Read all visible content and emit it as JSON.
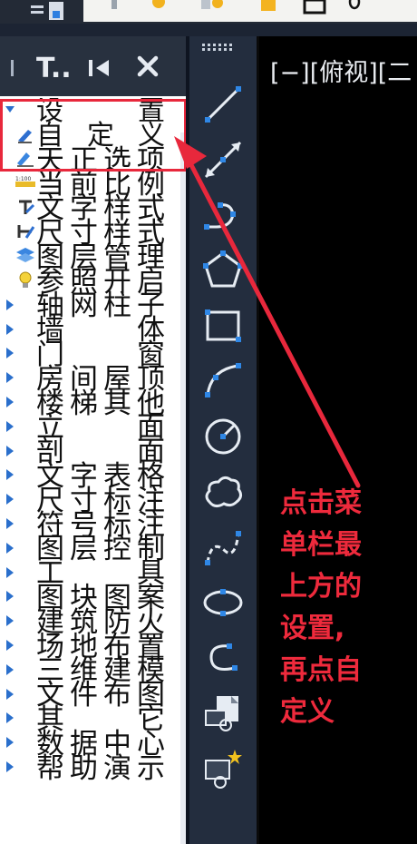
{
  "panel": {
    "title": "T..",
    "tree": [
      {
        "label": "设　置",
        "expanded": true,
        "icon": null
      },
      {
        "label": "自定义",
        "icon": "custom-settings-icon"
      },
      {
        "label": "天正选项",
        "icon": "options-icon"
      },
      {
        "label": "当前比例",
        "icon": "scale-icon"
      },
      {
        "label": "文字样式",
        "icon": "text-style-icon"
      },
      {
        "label": "尺寸样式",
        "icon": "dimension-style-icon"
      },
      {
        "label": "图层管理",
        "icon": "layers-icon"
      },
      {
        "label": "参照开启",
        "icon": "lightbulb-icon"
      },
      {
        "label": "轴网柱子",
        "icon": null
      },
      {
        "label": "墙　体",
        "icon": null
      },
      {
        "label": "门　窗",
        "icon": null
      },
      {
        "label": "房间屋顶",
        "icon": null
      },
      {
        "label": "楼梯其他",
        "icon": null
      },
      {
        "label": "立　面",
        "icon": null
      },
      {
        "label": "剖　面",
        "icon": null
      },
      {
        "label": "文字表格",
        "icon": null
      },
      {
        "label": "尺寸标注",
        "icon": null
      },
      {
        "label": "符号标注",
        "icon": null
      },
      {
        "label": "图层控制",
        "icon": null
      },
      {
        "label": "工　具",
        "icon": null
      },
      {
        "label": "图块图案",
        "icon": null
      },
      {
        "label": "建筑防火",
        "icon": null
      },
      {
        "label": "场地布置",
        "icon": null
      },
      {
        "label": "三维建模",
        "icon": null
      },
      {
        "label": "文件布图",
        "icon": null
      },
      {
        "label": "其　它",
        "icon": null
      },
      {
        "label": "数据中心",
        "icon": null
      },
      {
        "label": "帮助演示",
        "icon": null
      }
    ],
    "scale_badge": "1:100"
  },
  "toolbar": {
    "tools": [
      "line-icon",
      "construction-line-icon",
      "polyline-icon",
      "polygon-icon",
      "rectangle-icon",
      "arc-icon",
      "circle-icon",
      "revision-cloud-icon",
      "spline-icon",
      "ellipse-icon",
      "ellipse-arc-icon",
      "insert-block-icon",
      "create-block-icon"
    ]
  },
  "canvas": {
    "view_label": "[−][俯视][二"
  },
  "annotation": {
    "lines": [
      "点击菜",
      "单栏最",
      "上方的",
      "设置,",
      "再点自",
      "定义"
    ]
  },
  "colors": {
    "accent_red": "#e8283c",
    "icon_blue": "#2f87e6",
    "toolbar_bg": "#232d3e"
  }
}
